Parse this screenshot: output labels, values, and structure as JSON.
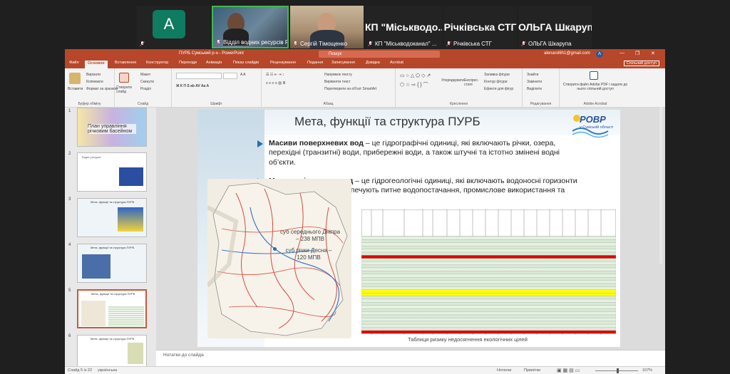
{
  "meeting": {
    "participants": [
      {
        "id": "a",
        "avatar_letter": "A",
        "name": ""
      },
      {
        "id": "v1",
        "name": "Відділ водних ресурсів Р..."
      },
      {
        "id": "v2",
        "name": "Сергій Тімощенко"
      },
      {
        "id": "t3",
        "big": "КП \"Міськводо...",
        "name": "КП \"Міськводоканал\" ..."
      },
      {
        "id": "t4",
        "big": "Річківська СТГ",
        "name": "Річківська СТГ"
      },
      {
        "id": "t5",
        "big": "ОЛЬГА Шкарупа",
        "name": "ОЛЬГА Шкарупа"
      }
    ]
  },
  "window": {
    "title": "ПУРБ Сумський р-н  -  PowerPoint",
    "search_placeholder": "Пошук",
    "user_email": "alenarol6h1@gmail.com",
    "user_initial": "A",
    "share_label": "Спільний доступ"
  },
  "ribbon_tabs": [
    "Файл",
    "Основне",
    "Вставлення",
    "Конструктор",
    "Переходи",
    "Анімація",
    "Показ слайдів",
    "Рецензування",
    "Подання",
    "Записування",
    "Довідка",
    "Acrobat"
  ],
  "ribbon": {
    "clipboard": {
      "paste": "Вставити",
      "cut": "Вирізати",
      "copy": "Копіювати",
      "format": "Формат за зразком",
      "label": "Буфер обміну"
    },
    "slides": {
      "new": "Створити слайд",
      "layout": "Макет",
      "reset": "Скинути",
      "section": "Розділ",
      "label": "Слайд"
    },
    "font": {
      "label": "Шрифт"
    },
    "paragraph": {
      "dir": "Напрямок тексту",
      "align": "Вирівняти текст",
      "smartart": "Перетворити на об'єкт SmartArt",
      "label": "Абзац"
    },
    "drawing": {
      "arrange": "Упорядкувати",
      "styles": "Експрес-стилі",
      "fill": "Заливка фігури",
      "outline": "Контур фігури",
      "effects": "Ефекти для фігур",
      "label": "Креслення"
    },
    "editing": {
      "find": "Знайти",
      "replace": "Замінити",
      "select": "Виділити",
      "label": "Редагування"
    },
    "acrobat": {
      "create": "Створити файл Adobe PDF і надати до нього спільний доступ",
      "label": "Adobe Acrobat"
    }
  },
  "thumbnails": [
    {
      "num": "1",
      "title": "План управління річковим басейном"
    },
    {
      "num": "2",
      "title": "Водні ресурси"
    },
    {
      "num": "3",
      "title": "Мета, функції та структура ПУРБ"
    },
    {
      "num": "4",
      "title": "Мета, функції та структура ПУРБ"
    },
    {
      "num": "5",
      "title": "Мета, функції та структура ПУРБ"
    },
    {
      "num": "6",
      "title": "Мета, функції та структура ПУРБ"
    }
  ],
  "slide": {
    "title": "Мета, функції та структура ПУРБ",
    "logo_text": "РОВР",
    "logo_sub": "у Сумській області",
    "bullet1_bold": "Масиви поверхневих вод",
    "bullet1_text": " – це гідрографічні одиниці, які включають річки, озера, перехідні (транзитні) води, прибережні води, а також штучні та істотно змінені водні об’єкти.",
    "bullet2_bold": "Масиви підземних вод",
    "bullet2_text": " – це гідрогеологічні одиниці, які включають водоносні горизонти та комплекси, що забезпечують питне водопостачання, промислове використання та підтримку екосистем.",
    "map_label1": "суб середнього Дніпра – 238 МПВ",
    "map_label2": "суб річки Десна – 120 МПВ",
    "table_caption": "Таблиця ризику недосягнення екологічних цілей"
  },
  "notes_placeholder": "Нотатки до слайда",
  "status": {
    "slide_counter": "Слайд 5 із 22",
    "language": "українська",
    "notes": "Нотатки",
    "comments": "Примітки",
    "zoom": "107%"
  },
  "colors": {
    "accent": "#b7472a",
    "brand_blue": "#2b6cb0",
    "meeting_bg": "#1f1f1f"
  }
}
